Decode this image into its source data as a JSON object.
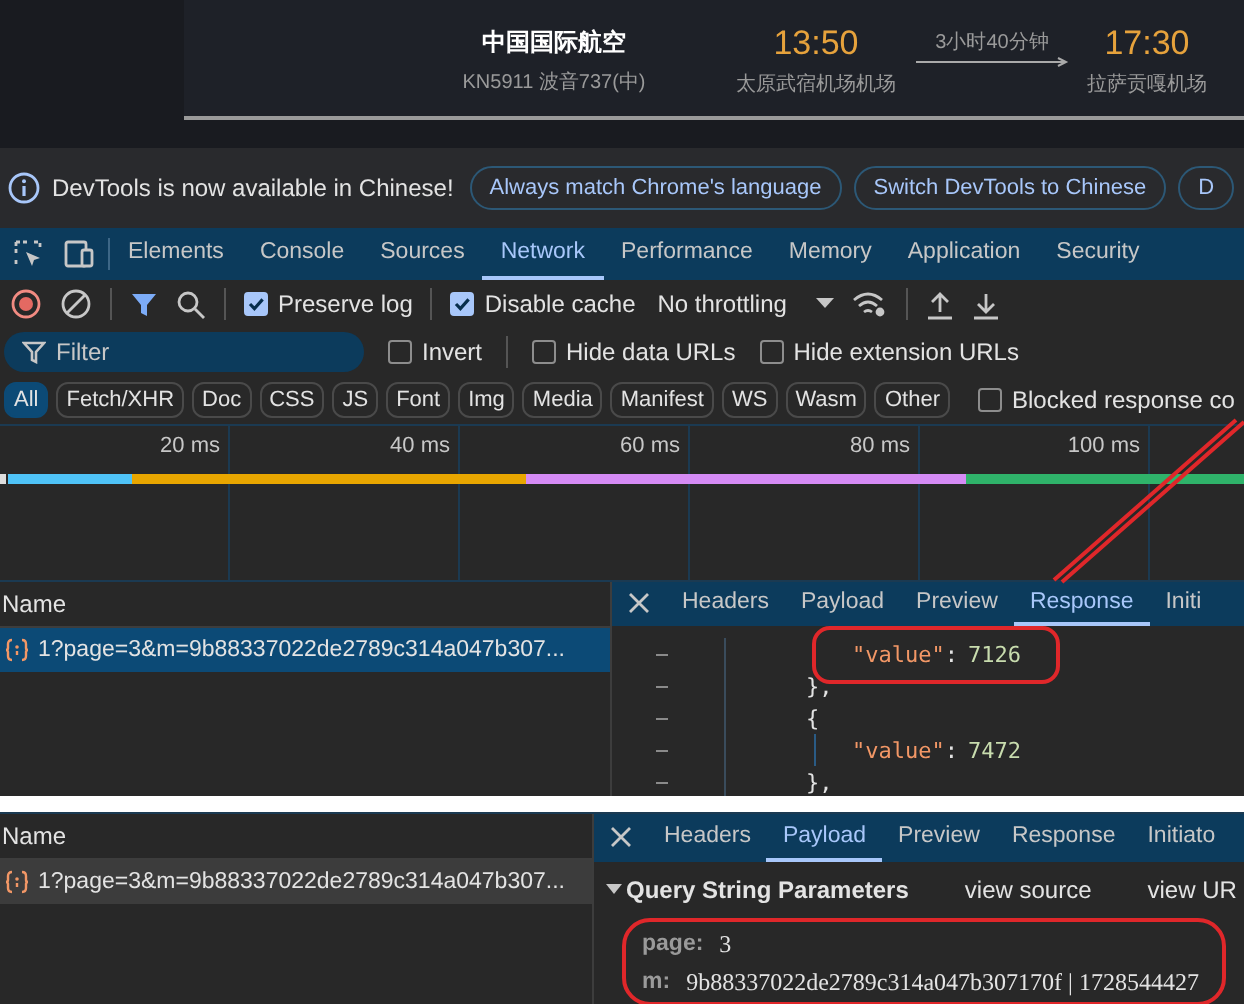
{
  "flight": {
    "airline": "中国国际航空",
    "flight_no": "KN5911 波音737(中)",
    "depart_time": "13:50",
    "depart_airport": "太原武宿机场机场",
    "duration": "3小时40分钟",
    "arrive_time": "17:30",
    "arrive_airport": "拉萨贡嘎机场"
  },
  "infobar": {
    "message": "DevTools is now available in Chinese!",
    "buttons": [
      "Always match Chrome's language",
      "Switch DevTools to Chinese",
      "D"
    ]
  },
  "panel_tabs": [
    {
      "label": "Elements",
      "selected": false
    },
    {
      "label": "Console",
      "selected": false
    },
    {
      "label": "Sources",
      "selected": false
    },
    {
      "label": "Network",
      "selected": true
    },
    {
      "label": "Performance",
      "selected": false
    },
    {
      "label": "Memory",
      "selected": false
    },
    {
      "label": "Application",
      "selected": false
    },
    {
      "label": "Security",
      "selected": false
    }
  ],
  "toolbar": {
    "recording": true,
    "checkboxes": [
      {
        "label": "Preserve log",
        "checked": true
      },
      {
        "label": "Disable cache",
        "checked": true
      }
    ],
    "throttling": "No throttling"
  },
  "filter": {
    "placeholder": "Filter",
    "options": [
      {
        "label": "Invert",
        "checked": false
      },
      {
        "label": "Hide data URLs",
        "checked": false
      },
      {
        "label": "Hide extension URLs",
        "checked": false
      }
    ]
  },
  "type_filters": [
    {
      "label": "All",
      "selected": true
    },
    {
      "label": "Fetch/XHR",
      "selected": false
    },
    {
      "label": "Doc",
      "selected": false
    },
    {
      "label": "CSS",
      "selected": false
    },
    {
      "label": "JS",
      "selected": false
    },
    {
      "label": "Font",
      "selected": false
    },
    {
      "label": "Img",
      "selected": false
    },
    {
      "label": "Media",
      "selected": false
    },
    {
      "label": "Manifest",
      "selected": false
    },
    {
      "label": "WS",
      "selected": false
    },
    {
      "label": "Wasm",
      "selected": false
    },
    {
      "label": "Other",
      "selected": false
    }
  ],
  "blocked_option": {
    "label": "Blocked response co",
    "checked": false
  },
  "timeline": {
    "ticks": [
      "20 ms",
      "40 ms",
      "60 ms",
      "80 ms",
      "100 ms"
    ]
  },
  "panels": [
    {
      "kind": "response",
      "name_header": "Name",
      "requests": [
        {
          "name": "1?page=3&m=9b88337022de2789c314a047b307...",
          "selected": true
        }
      ],
      "detail_tabs": [
        {
          "label": "Headers",
          "selected": false
        },
        {
          "label": "Payload",
          "selected": false
        },
        {
          "label": "Preview",
          "selected": false
        },
        {
          "label": "Response",
          "selected": true
        },
        {
          "label": "Initi",
          "selected": false
        }
      ],
      "lines": [
        {
          "kind": "pair",
          "key": "\"value\"",
          "punct": ":",
          "value": "7126",
          "highlighted": true
        },
        {
          "kind": "brace",
          "text": "},"
        },
        {
          "kind": "brace",
          "text": "{"
        },
        {
          "kind": "pair",
          "key": "\"value\"",
          "punct": ":",
          "value": "7472",
          "highlighted": false
        },
        {
          "kind": "brace",
          "text": "},"
        }
      ]
    },
    {
      "kind": "payload",
      "name_header": "Name",
      "requests": [
        {
          "name": "1?page=3&m=9b88337022de2789c314a047b307...",
          "selected": false
        }
      ],
      "detail_tabs": [
        {
          "label": "Headers",
          "selected": false
        },
        {
          "label": "Payload",
          "selected": true
        },
        {
          "label": "Preview",
          "selected": false
        },
        {
          "label": "Response",
          "selected": false
        },
        {
          "label": "Initiato",
          "selected": false
        }
      ],
      "section": {
        "title": "Query String Parameters",
        "expanded": true,
        "links": [
          "view source",
          "view UR"
        ],
        "highlighted": true,
        "params": [
          {
            "key": "page:",
            "value": "3"
          },
          {
            "key": "m:",
            "value": "9b88337022de2789c314a047b307170f | 1728544427"
          }
        ]
      }
    }
  ]
}
